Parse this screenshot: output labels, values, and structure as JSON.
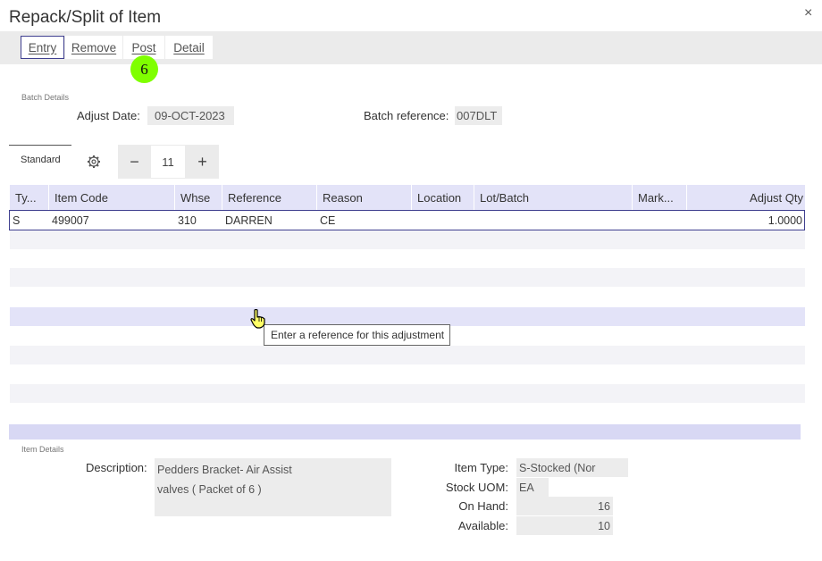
{
  "window": {
    "title": "Repack/Split of Item",
    "close_label": "×"
  },
  "toolbar": {
    "buttons": [
      {
        "label": "Entry"
      },
      {
        "label": "Remove"
      },
      {
        "label": "Post"
      },
      {
        "label": "Detail"
      }
    ]
  },
  "step_badge": "6",
  "batch": {
    "section_label": "Batch Details",
    "adjust_date_label": "Adjust Date:",
    "adjust_date_value": "09-OCT-2023",
    "batch_ref_label": "Batch reference:",
    "batch_ref_value": "007DLT"
  },
  "grid_toolbar": {
    "tab_label": "Standard",
    "gear_icon": "gear-icon",
    "stepper": {
      "minus": "−",
      "value": "11",
      "plus": "+"
    }
  },
  "grid": {
    "columns": [
      "Ty...",
      "Item Code",
      "Whse",
      "Reference",
      "Reason",
      "Location",
      "Lot/Batch",
      "Mark...",
      "Adjust Qty"
    ],
    "rows": [
      [
        "S",
        "499007",
        "310",
        "DARREN",
        "CE",
        "",
        "",
        "",
        "1.0000"
      ]
    ]
  },
  "tooltip": "Enter a reference for this adjustment",
  "item": {
    "section_label": "Item Details",
    "description_label": "Description:",
    "description_line1": "Pedders Bracket- Air Assist",
    "description_line2": "valves ( Packet of 6 )",
    "item_type_label": "Item Type:",
    "item_type_value": "S-Stocked (Nor",
    "stock_uom_label": "Stock UOM:",
    "stock_uom_value": "EA",
    "on_hand_label": "On Hand:",
    "on_hand_value": "16",
    "available_label": "Available:",
    "available_value": "10"
  },
  "colors": {
    "accent": "#3f3f8f",
    "header_bg": "#e3e3f8",
    "badge": "#7fff00"
  }
}
